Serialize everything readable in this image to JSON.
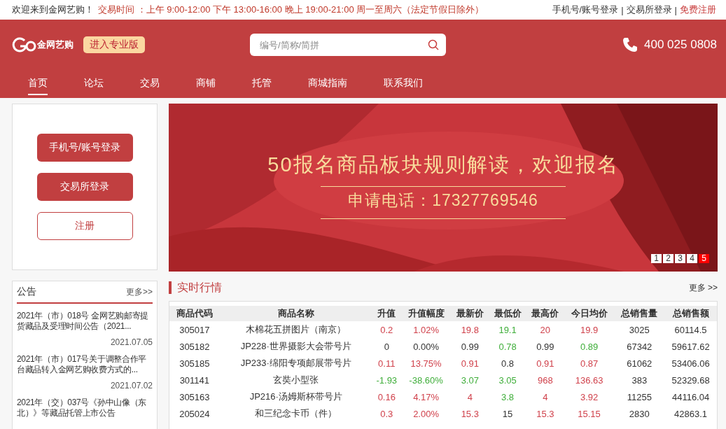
{
  "top_bar": {
    "welcome": "欢迎来到金网艺购！",
    "hours": "交易时间 ：上午 9:00-12:00 下午 13:00-16:00 晚上 19:00-21:00 周一至周六（法定节假日除外）",
    "separator": "|",
    "links": [
      {
        "label": "手机号/账号登录",
        "kind": "plain"
      },
      {
        "label": "交易所登录",
        "kind": "plain"
      },
      {
        "label": "免费注册",
        "kind": "accent"
      }
    ]
  },
  "header": {
    "logo": "金网艺购",
    "pro_button": "进入专业版",
    "search": {
      "placeholder": "编号/简称/简拼"
    },
    "phone": "400 025 0808"
  },
  "nav": [
    {
      "label": "首页",
      "selected": true
    },
    {
      "label": "论坛",
      "selected": false
    },
    {
      "label": "交易",
      "selected": false
    },
    {
      "label": "商铺",
      "selected": false
    },
    {
      "label": "托管",
      "selected": false
    },
    {
      "label": "商城指南",
      "selected": false
    },
    {
      "label": "联系我们",
      "selected": false
    }
  ],
  "login_box": {
    "buttons": [
      {
        "label": "手机号/账号登录",
        "kind": "filled"
      },
      {
        "label": "交易所登录",
        "kind": "filled"
      },
      {
        "label": "注册",
        "kind": "outline"
      }
    ]
  },
  "notices": {
    "title": "公告",
    "more": "更多>>",
    "items": [
      {
        "text": "2021年（市）018号 金网艺购邮寄提货藏品及受理时间公告（2021...",
        "date": "2021.07.05"
      },
      {
        "text": "2021年（市）017号关于调整合作平台藏品转入金网艺购收费方式的...",
        "date": "2021.07.02"
      },
      {
        "text": "2021年（交）037号《孙中山像（东北）》等藏品托管上市公告"
      }
    ]
  },
  "banner": {
    "headline": "50报名商品板块规则解读，欢迎报名",
    "subline": "申请电话：17327769546",
    "pages": [
      {
        "label": "1",
        "selected": false
      },
      {
        "label": "2",
        "selected": false
      },
      {
        "label": "3",
        "selected": false
      },
      {
        "label": "4",
        "selected": false
      },
      {
        "label": "5",
        "selected": true
      }
    ]
  },
  "market": {
    "title": "实时行情",
    "more": "更多 >>",
    "table": {
      "columns": [
        "商品代码",
        "商品名称",
        "升值",
        "升值幅度",
        "最新价",
        "最低价",
        "最高价",
        "今日均价",
        "总销售量",
        "总销售额"
      ],
      "rows": [
        [
          {
            "text": "305017"
          },
          {
            "text": "木棉花五拼图片（南京）"
          },
          {
            "text": "0.2",
            "color": "#d0414b"
          },
          {
            "text": "1.02%",
            "color": "#d0414b"
          },
          {
            "text": "19.8",
            "color": "#d0414b"
          },
          {
            "text": "19.1",
            "color": "#3fae3a"
          },
          {
            "text": "20",
            "color": "#d0414b"
          },
          {
            "text": "19.9",
            "color": "#d0414b"
          },
          {
            "text": "3025"
          },
          {
            "text": "60114.5"
          }
        ],
        [
          {
            "text": "305182"
          },
          {
            "text": "JP228·世界摄影大会带号片"
          },
          {
            "text": "0"
          },
          {
            "text": "0.00%"
          },
          {
            "text": "0.99"
          },
          {
            "text": "0.78",
            "color": "#3fae3a"
          },
          {
            "text": "0.99"
          },
          {
            "text": "0.89",
            "color": "#3fae3a"
          },
          {
            "text": "67342"
          },
          {
            "text": "59617.62"
          }
        ],
        [
          {
            "text": "305185"
          },
          {
            "text": "JP233·绵阳专项邮展带号片"
          },
          {
            "text": "0.11",
            "color": "#d0414b"
          },
          {
            "text": "13.75%",
            "color": "#d0414b"
          },
          {
            "text": "0.91",
            "color": "#d0414b"
          },
          {
            "text": "0.8"
          },
          {
            "text": "0.91",
            "color": "#d0414b"
          },
          {
            "text": "0.87",
            "color": "#d0414b"
          },
          {
            "text": "61062"
          },
          {
            "text": "53406.06"
          }
        ],
        [
          {
            "text": "301141"
          },
          {
            "text": "玄奘小型张"
          },
          {
            "text": "-1.93",
            "color": "#3fae3a"
          },
          {
            "text": "-38.60%",
            "color": "#3fae3a"
          },
          {
            "text": "3.07",
            "color": "#3fae3a"
          },
          {
            "text": "3.05",
            "color": "#3fae3a"
          },
          {
            "text": "968",
            "color": "#d0414b"
          },
          {
            "text": "136.63",
            "color": "#d0414b"
          },
          {
            "text": "383"
          },
          {
            "text": "52329.68"
          }
        ],
        [
          {
            "text": "305163"
          },
          {
            "text": "JP216·汤姆斯杯带号片"
          },
          {
            "text": "0.16",
            "color": "#d0414b"
          },
          {
            "text": "4.17%",
            "color": "#d0414b"
          },
          {
            "text": "4",
            "color": "#d0414b"
          },
          {
            "text": "3.8",
            "color": "#3fae3a"
          },
          {
            "text": "4",
            "color": "#d0414b"
          },
          {
            "text": "3.92",
            "color": "#d0414b"
          },
          {
            "text": "11255"
          },
          {
            "text": "44116.04"
          }
        ],
        [
          {
            "text": "205024"
          },
          {
            "text": "和三纪念卡币（件）"
          },
          {
            "text": "0.3",
            "color": "#d0414b"
          },
          {
            "text": "2.00%",
            "color": "#d0414b"
          },
          {
            "text": "15.3",
            "color": "#d0414b"
          },
          {
            "text": "15"
          },
          {
            "text": "15.3",
            "color": "#d0414b"
          },
          {
            "text": "15.15",
            "color": "#d0414b"
          },
          {
            "text": "2830"
          },
          {
            "text": "42863.1"
          }
        ]
      ]
    }
  }
}
